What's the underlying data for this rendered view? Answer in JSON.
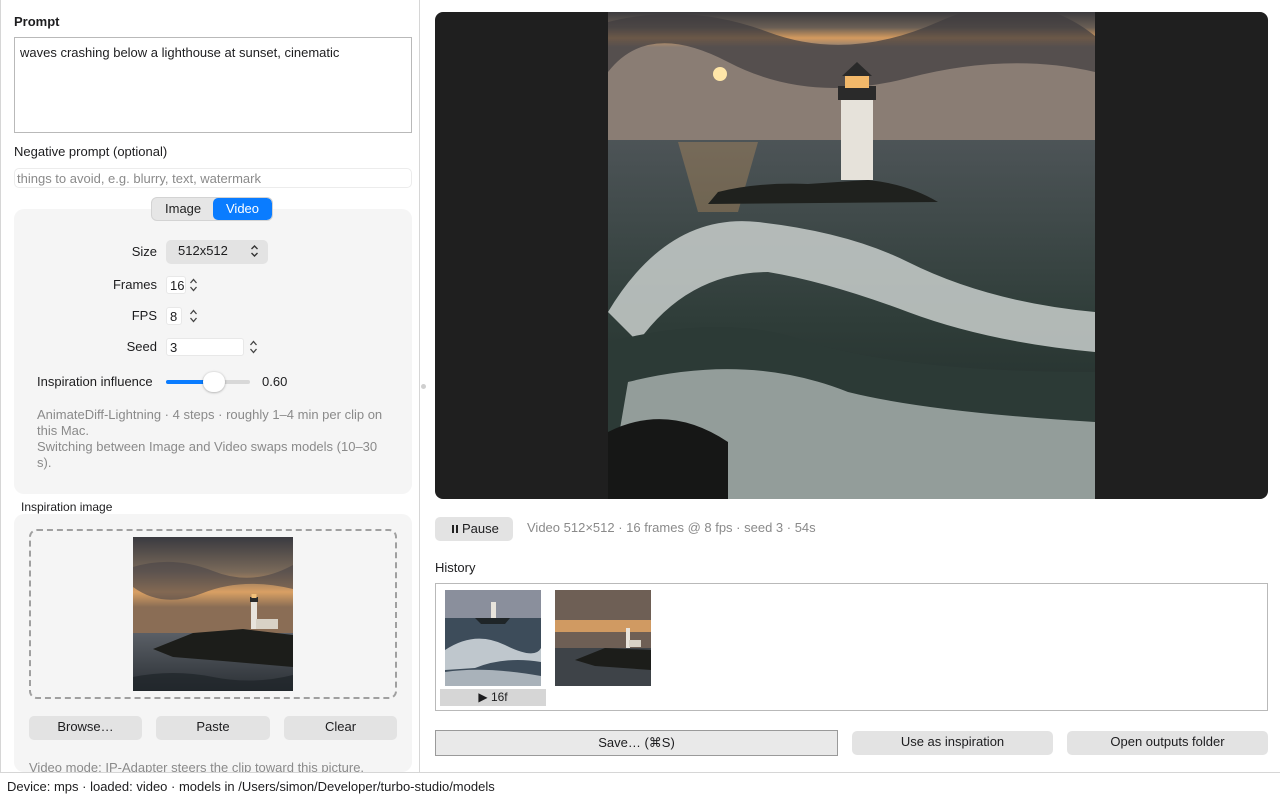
{
  "left": {
    "prompt_label": "Prompt",
    "prompt_text": "waves crashing below a lighthouse at sunset, cinematic",
    "negative_label": "Negative prompt (optional)",
    "negative_placeholder": "things to avoid, e.g. blurry, text, watermark",
    "mode_tabs": [
      {
        "label": "Image",
        "selected": false
      },
      {
        "label": "Video",
        "selected": true
      }
    ],
    "size_label": "Size",
    "size_value": "512x512",
    "frames_label": "Frames",
    "frames_value": "16",
    "fps_label": "FPS",
    "fps_value": "8",
    "seed_label": "Seed",
    "seed_value": "3",
    "influence_label": "Inspiration influence",
    "influence_value": "0.60",
    "influence_level": 0.6,
    "note_line1": "AnimateDiff-Lightning · 4 steps · roughly 1–4 min per clip on this Mac.",
    "note_line2": "Switching between Image and Video swaps models (10–30 s).",
    "inspiration_label": "Inspiration image",
    "browse_label": "Browse…",
    "paste_label": "Paste",
    "clear_label": "Clear",
    "mode_hint": "Video mode: IP-Adapter steers the clip toward this picture."
  },
  "right": {
    "pause_label": "Pause",
    "status_text": "Video 512×512 · 16 frames @ 8 fps · seed 3 · 54s",
    "history_label": "History",
    "history_badge": "▶ 16f",
    "save_label": "Save…  (⌘S)",
    "use_inspiration_label": "Use as inspiration",
    "open_folder_label": "Open outputs folder"
  },
  "statusbar_text": "Device: mps · loaded: video · models in /Users/simon/Developer/turbo-studio/models",
  "colors": {
    "accent": "#0a7cff",
    "viewer_bg": "#1f1f1f",
    "card_bg": "#f5f5f5",
    "muted_text": "#8a8a8a"
  },
  "icons": [
    "pause-icon",
    "chevron-updown-icon",
    "stepper-icon",
    "play-icon"
  ]
}
